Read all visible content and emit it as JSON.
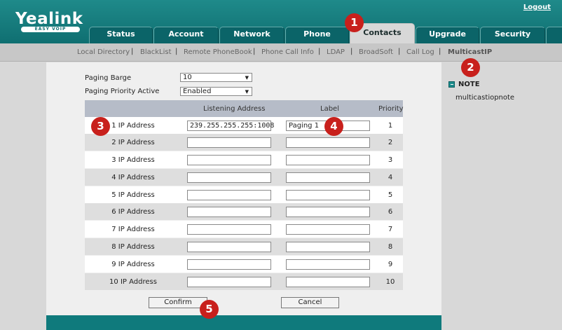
{
  "header": {
    "logo": "Yealink",
    "logo_tagline": "EASY VOIP",
    "logout": "Logout"
  },
  "tabs": [
    {
      "label": "Status"
    },
    {
      "label": "Account"
    },
    {
      "label": "Network"
    },
    {
      "label": "Phone"
    },
    {
      "label": "Contacts",
      "active": true
    },
    {
      "label": "Upgrade"
    },
    {
      "label": "Security"
    }
  ],
  "subnav": [
    {
      "label": "Local Directory"
    },
    {
      "label": "BlackList"
    },
    {
      "label": "Remote PhoneBook"
    },
    {
      "label": "Phone Call Info"
    },
    {
      "label": "LDAP"
    },
    {
      "label": "BroadSoft"
    },
    {
      "label": "Call Log"
    },
    {
      "label": "MulticastIP",
      "active": true
    }
  ],
  "form": {
    "paging_barge": {
      "label": "Paging Barge",
      "value": "10"
    },
    "paging_priority": {
      "label": "Paging Priority Active",
      "value": "Enabled"
    }
  },
  "table": {
    "headers": {
      "address": "Listening Address",
      "label": "Label",
      "priority": "Priority"
    },
    "rows": [
      {
        "name": "1 IP Address",
        "address": "239.255.255.255:1008",
        "label": "Paging 1",
        "priority": "1"
      },
      {
        "name": "2 IP Address",
        "address": "",
        "label": "",
        "priority": "2"
      },
      {
        "name": "3 IP Address",
        "address": "",
        "label": "",
        "priority": "3"
      },
      {
        "name": "4 IP Address",
        "address": "",
        "label": "",
        "priority": "4"
      },
      {
        "name": "5 IP Address",
        "address": "",
        "label": "",
        "priority": "5"
      },
      {
        "name": "6 IP Address",
        "address": "",
        "label": "",
        "priority": "6"
      },
      {
        "name": "7 IP Address",
        "address": "",
        "label": "",
        "priority": "7"
      },
      {
        "name": "8 IP Address",
        "address": "",
        "label": "",
        "priority": "8"
      },
      {
        "name": "9 IP Address",
        "address": "",
        "label": "",
        "priority": "9"
      },
      {
        "name": "10 IP Address",
        "address": "",
        "label": "",
        "priority": "10"
      }
    ]
  },
  "buttons": {
    "confirm": "Confirm",
    "cancel": "Cancel"
  },
  "note": {
    "title": "NOTE",
    "text": "multicastiopnote"
  },
  "badges": [
    "1",
    "2",
    "3",
    "4",
    "5"
  ],
  "colors": {
    "header": "#0f6f71",
    "badge": "#c8201c",
    "table_header": "#b6bcc8"
  }
}
